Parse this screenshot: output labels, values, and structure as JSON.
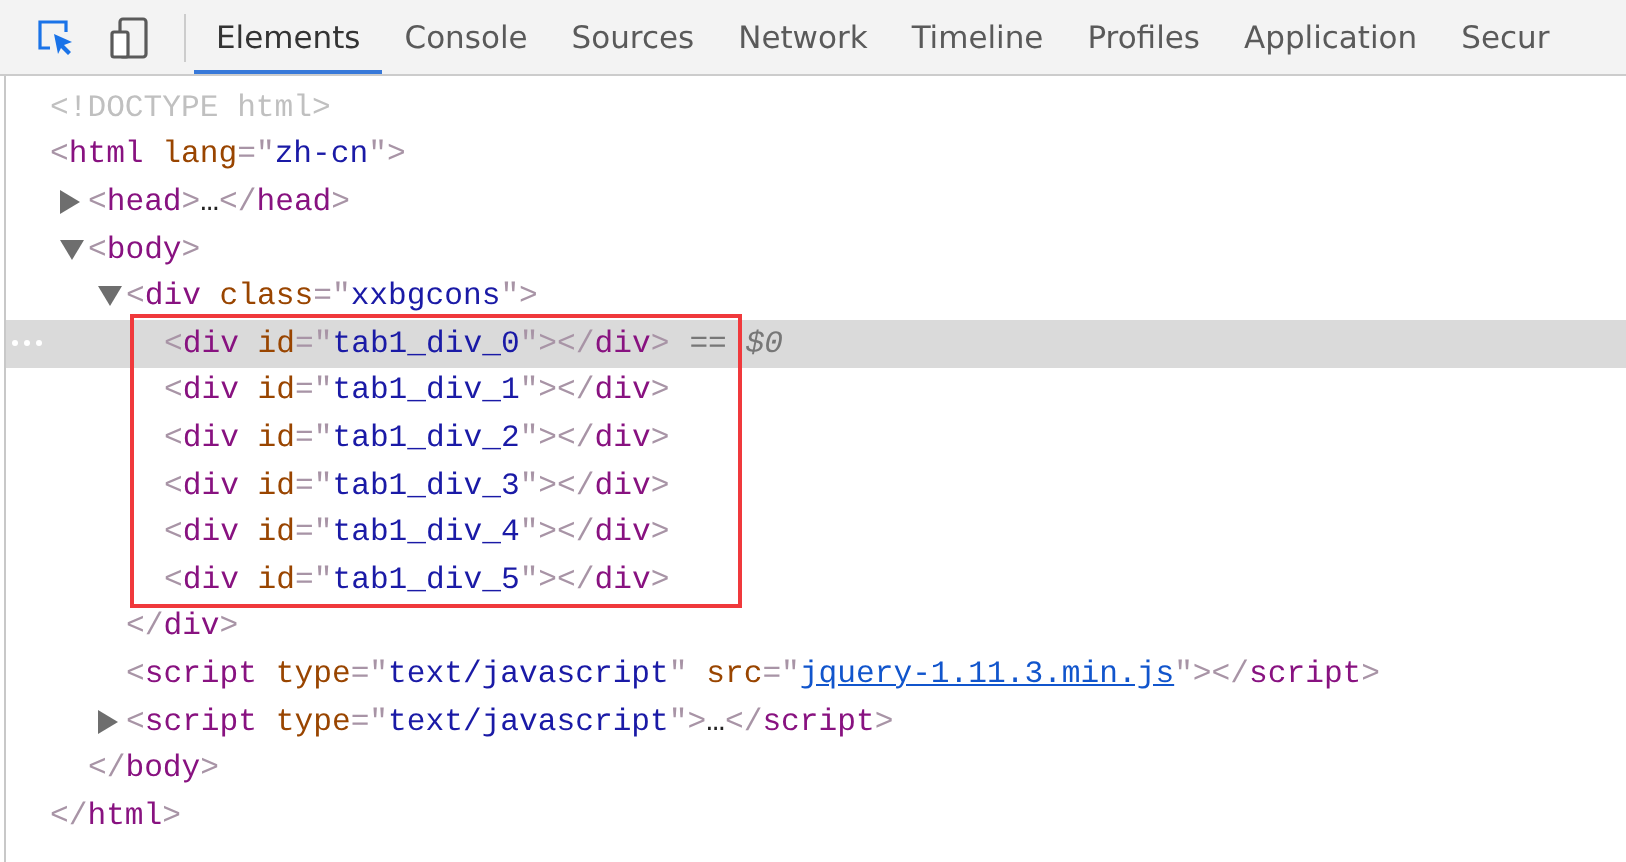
{
  "tabs": [
    {
      "label": "Elements",
      "selected": true
    },
    {
      "label": "Console",
      "selected": false
    },
    {
      "label": "Sources",
      "selected": false
    },
    {
      "label": "Network",
      "selected": false
    },
    {
      "label": "Timeline",
      "selected": false
    },
    {
      "label": "Profiles",
      "selected": false
    },
    {
      "label": "Application",
      "selected": false
    },
    {
      "label": "Secur",
      "selected": false
    }
  ],
  "tree": [
    {
      "selected": false,
      "open": [
        {
          "kind": "doctype",
          "text": "<!DOCTYPE html>"
        }
      ]
    },
    {
      "selected": false,
      "open": [
        {
          "kind": "punct",
          "text": "<"
        },
        {
          "kind": "tag",
          "text": "html"
        },
        {
          "kind": "attr",
          "text": " lang"
        },
        {
          "kind": "punct",
          "text": "=\""
        },
        {
          "kind": "value",
          "text": "zh-cn"
        },
        {
          "kind": "punct",
          "text": "\">"
        }
      ],
      "close": [
        {
          "kind": "punct",
          "text": "</"
        },
        {
          "kind": "tag",
          "text": "html"
        },
        {
          "kind": "punct",
          "text": ">"
        }
      ],
      "children": [
        {
          "selected": false,
          "expanded": false,
          "open": [
            {
              "kind": "punct",
              "text": "<"
            },
            {
              "kind": "tag",
              "text": "head"
            },
            {
              "kind": "punct",
              "text": ">"
            },
            {
              "kind": "text",
              "text": "…"
            },
            {
              "kind": "punct",
              "text": "</"
            },
            {
              "kind": "tag",
              "text": "head"
            },
            {
              "kind": "punct",
              "text": ">"
            }
          ]
        },
        {
          "selected": false,
          "expanded": true,
          "open": [
            {
              "kind": "punct",
              "text": "<"
            },
            {
              "kind": "tag",
              "text": "body"
            },
            {
              "kind": "punct",
              "text": ">"
            }
          ],
          "close": [
            {
              "kind": "punct",
              "text": "</"
            },
            {
              "kind": "tag",
              "text": "body"
            },
            {
              "kind": "punct",
              "text": ">"
            }
          ],
          "children": [
            {
              "selected": false,
              "expanded": true,
              "outlined_children": true,
              "open": [
                {
                  "kind": "punct",
                  "text": "<"
                },
                {
                  "kind": "tag",
                  "text": "div"
                },
                {
                  "kind": "attr",
                  "text": " class"
                },
                {
                  "kind": "punct",
                  "text": "=\""
                },
                {
                  "kind": "value",
                  "text": "xxbgcons"
                },
                {
                  "kind": "punct",
                  "text": "\">"
                }
              ],
              "close": [
                {
                  "kind": "punct",
                  "text": "</"
                },
                {
                  "kind": "tag",
                  "text": "div"
                },
                {
                  "kind": "punct",
                  "text": ">"
                }
              ],
              "children": [
                {
                  "selected": true,
                  "reference": "== *$0*",
                  "open": [
                    {
                      "kind": "punct",
                      "text": "<"
                    },
                    {
                      "kind": "tag",
                      "text": "div"
                    },
                    {
                      "kind": "attr",
                      "text": " id"
                    },
                    {
                      "kind": "punct",
                      "text": "=\""
                    },
                    {
                      "kind": "value",
                      "text": "tab1_div_0"
                    },
                    {
                      "kind": "punct",
                      "text": "\">"
                    },
                    {
                      "kind": "punct",
                      "text": "</"
                    },
                    {
                      "kind": "tag",
                      "text": "div"
                    },
                    {
                      "kind": "punct",
                      "text": ">"
                    }
                  ]
                },
                {
                  "selected": false,
                  "open": [
                    {
                      "kind": "punct",
                      "text": "<"
                    },
                    {
                      "kind": "tag",
                      "text": "div"
                    },
                    {
                      "kind": "attr",
                      "text": " id"
                    },
                    {
                      "kind": "punct",
                      "text": "=\""
                    },
                    {
                      "kind": "value",
                      "text": "tab1_div_1"
                    },
                    {
                      "kind": "punct",
                      "text": "\">"
                    },
                    {
                      "kind": "punct",
                      "text": "</"
                    },
                    {
                      "kind": "tag",
                      "text": "div"
                    },
                    {
                      "kind": "punct",
                      "text": ">"
                    }
                  ]
                },
                {
                  "selected": false,
                  "open": [
                    {
                      "kind": "punct",
                      "text": "<"
                    },
                    {
                      "kind": "tag",
                      "text": "div"
                    },
                    {
                      "kind": "attr",
                      "text": " id"
                    },
                    {
                      "kind": "punct",
                      "text": "=\""
                    },
                    {
                      "kind": "value",
                      "text": "tab1_div_2"
                    },
                    {
                      "kind": "punct",
                      "text": "\">"
                    },
                    {
                      "kind": "punct",
                      "text": "</"
                    },
                    {
                      "kind": "tag",
                      "text": "div"
                    },
                    {
                      "kind": "punct",
                      "text": ">"
                    }
                  ]
                },
                {
                  "selected": false,
                  "open": [
                    {
                      "kind": "punct",
                      "text": "<"
                    },
                    {
                      "kind": "tag",
                      "text": "div"
                    },
                    {
                      "kind": "attr",
                      "text": " id"
                    },
                    {
                      "kind": "punct",
                      "text": "=\""
                    },
                    {
                      "kind": "value",
                      "text": "tab1_div_3"
                    },
                    {
                      "kind": "punct",
                      "text": "\">"
                    },
                    {
                      "kind": "punct",
                      "text": "</"
                    },
                    {
                      "kind": "tag",
                      "text": "div"
                    },
                    {
                      "kind": "punct",
                      "text": ">"
                    }
                  ]
                },
                {
                  "selected": false,
                  "open": [
                    {
                      "kind": "punct",
                      "text": "<"
                    },
                    {
                      "kind": "tag",
                      "text": "div"
                    },
                    {
                      "kind": "attr",
                      "text": " id"
                    },
                    {
                      "kind": "punct",
                      "text": "=\""
                    },
                    {
                      "kind": "value",
                      "text": "tab1_div_4"
                    },
                    {
                      "kind": "punct",
                      "text": "\">"
                    },
                    {
                      "kind": "punct",
                      "text": "</"
                    },
                    {
                      "kind": "tag",
                      "text": "div"
                    },
                    {
                      "kind": "punct",
                      "text": ">"
                    }
                  ]
                },
                {
                  "selected": false,
                  "open": [
                    {
                      "kind": "punct",
                      "text": "<"
                    },
                    {
                      "kind": "tag",
                      "text": "div"
                    },
                    {
                      "kind": "attr",
                      "text": " id"
                    },
                    {
                      "kind": "punct",
                      "text": "=\""
                    },
                    {
                      "kind": "value",
                      "text": "tab1_div_5"
                    },
                    {
                      "kind": "punct",
                      "text": "\">"
                    },
                    {
                      "kind": "punct",
                      "text": "</"
                    },
                    {
                      "kind": "tag",
                      "text": "div"
                    },
                    {
                      "kind": "punct",
                      "text": ">"
                    }
                  ]
                }
              ]
            },
            {
              "selected": false,
              "open": [
                {
                  "kind": "punct",
                  "text": "<"
                },
                {
                  "kind": "tag",
                  "text": "script"
                },
                {
                  "kind": "attr",
                  "text": " type"
                },
                {
                  "kind": "punct",
                  "text": "=\""
                },
                {
                  "kind": "value",
                  "text": "text/javascript"
                },
                {
                  "kind": "punct",
                  "text": "\""
                },
                {
                  "kind": "attr",
                  "text": " src"
                },
                {
                  "kind": "punct",
                  "text": "=\""
                },
                {
                  "kind": "link",
                  "text": "jquery-1.11.3.min.js"
                },
                {
                  "kind": "punct",
                  "text": "\">"
                },
                {
                  "kind": "punct",
                  "text": "</"
                },
                {
                  "kind": "tag",
                  "text": "script"
                },
                {
                  "kind": "punct",
                  "text": ">"
                }
              ]
            },
            {
              "selected": false,
              "expanded": false,
              "open": [
                {
                  "kind": "punct",
                  "text": "<"
                },
                {
                  "kind": "tag",
                  "text": "script"
                },
                {
                  "kind": "attr",
                  "text": " type"
                },
                {
                  "kind": "punct",
                  "text": "=\""
                },
                {
                  "kind": "value",
                  "text": "text/javascript"
                },
                {
                  "kind": "punct",
                  "text": "\">"
                },
                {
                  "kind": "text",
                  "text": "…"
                },
                {
                  "kind": "punct",
                  "text": "</"
                },
                {
                  "kind": "tag",
                  "text": "script"
                },
                {
                  "kind": "punct",
                  "text": ">"
                }
              ]
            }
          ]
        }
      ]
    }
  ]
}
